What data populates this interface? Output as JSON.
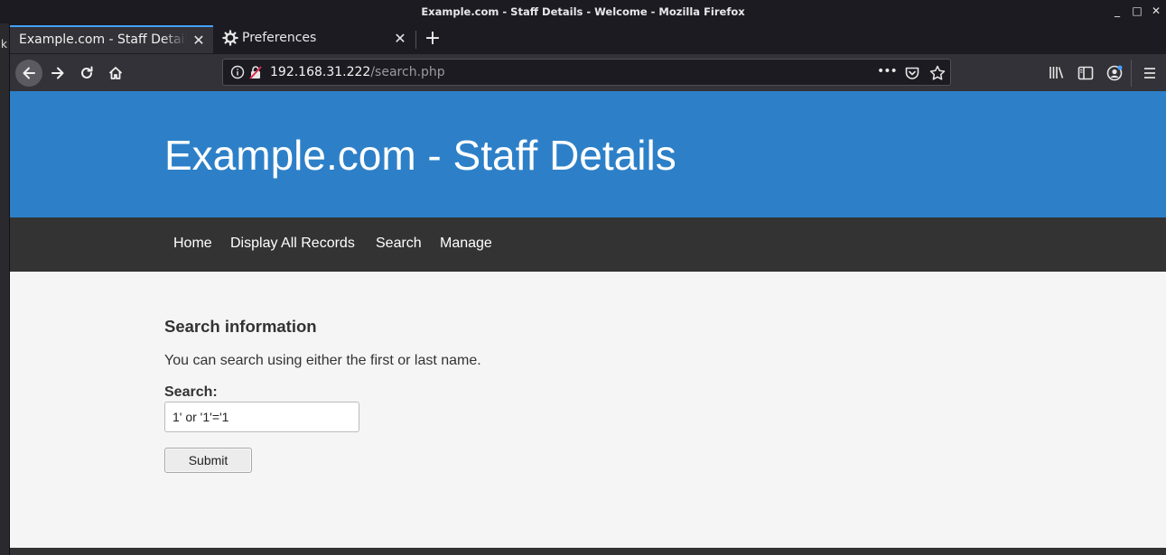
{
  "window": {
    "title": "Example.com - Staff Details - Welcome - Mozilla Firefox",
    "controls": [
      "_",
      "□",
      "✕"
    ],
    "left_strip_char": "k"
  },
  "tabs": [
    {
      "label": "Example.com - Staff Details - Welcome",
      "active": true,
      "close": "✕"
    },
    {
      "label": "Preferences",
      "active": false,
      "close": "✕"
    }
  ],
  "new_tab": "+",
  "urlbar": {
    "host": "192.168.31.222",
    "path": "/search.php",
    "more": "•••"
  },
  "site": {
    "header_title": "Example.com - Staff Details",
    "nav": [
      "Home",
      "Display All Records",
      "Search",
      "Manage"
    ]
  },
  "search_form": {
    "heading": "Search information",
    "description": "You can search using either the first or last name.",
    "label": "Search:",
    "value": "1' or '1'='1",
    "submit_label": "Submit"
  },
  "colors": {
    "header_bg": "#2d80c8",
    "menu_bg": "#333333",
    "page_bg": "#f5f5f5",
    "tab_accent": "#45a1ff"
  }
}
